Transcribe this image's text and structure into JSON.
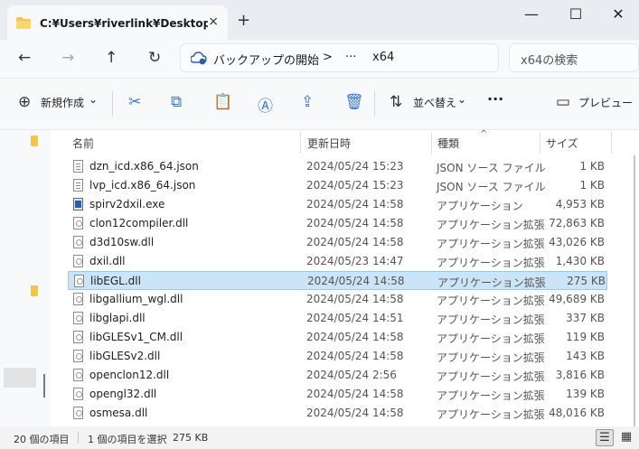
{
  "window": {
    "tab_title": "C:¥Users¥riverlink¥Desktop¥新",
    "tab_close_icon": "×",
    "new_tab_icon": "+",
    "minimize_icon": "—",
    "maximize_icon": "☐",
    "close_icon": "✕"
  },
  "nav": {
    "back_icon": "←",
    "forward_icon": "→",
    "up_icon": "↑",
    "refresh_icon": "↻"
  },
  "address": {
    "backup_label": "バックアップの開始",
    "chevron": ">",
    "ellipsis": "···",
    "current_folder": "x64"
  },
  "search": {
    "placeholder": "x64の検索"
  },
  "toolbar": {
    "new_label": "新規作成",
    "new_icon": "⊕",
    "dropdown_icon": "⌄",
    "cut_icon": "✂",
    "copy_icon": "⧉",
    "paste_icon": "📋",
    "rename_icon": "Ⓐ",
    "share_icon": "⇪",
    "delete_icon": "🗑",
    "sort_label": "並べ替え",
    "sort_icon": "⇅",
    "more_icon": "···",
    "preview_label": "プレビュー",
    "preview_icon": "▭"
  },
  "columns": {
    "name": "名前",
    "date": "更新日時",
    "type": "種類",
    "size": "サイズ",
    "sort_indicator": "^"
  },
  "files": [
    {
      "name": "dzn_icd.x86_64.json",
      "date": "2024/05/24 15:23",
      "type": "JSON ソース ファイル",
      "size": "1 KB",
      "kind": "json"
    },
    {
      "name": "lvp_icd.x86_64.json",
      "date": "2024/05/24 15:23",
      "type": "JSON ソース ファイル",
      "size": "1 KB",
      "kind": "json"
    },
    {
      "name": "spirv2dxil.exe",
      "date": "2024/05/24 14:58",
      "type": "アプリケーション",
      "size": "4,953 KB",
      "kind": "exe"
    },
    {
      "name": "clon12compiler.dll",
      "date": "2024/05/24 14:58",
      "type": "アプリケーション拡張",
      "size": "72,863 KB",
      "kind": "dll"
    },
    {
      "name": "d3d10sw.dll",
      "date": "2024/05/24 14:58",
      "type": "アプリケーション拡張",
      "size": "43,026 KB",
      "kind": "dll"
    },
    {
      "name": "dxil.dll",
      "date": "2024/05/23 14:47",
      "type": "アプリケーション拡張",
      "size": "1,430 KB",
      "kind": "dll"
    },
    {
      "name": "libEGL.dll",
      "date": "2024/05/24 14:58",
      "type": "アプリケーション拡張",
      "size": "275 KB",
      "kind": "dll",
      "selected": true
    },
    {
      "name": "libgallium_wgl.dll",
      "date": "2024/05/24 14:58",
      "type": "アプリケーション拡張",
      "size": "49,689 KB",
      "kind": "dll"
    },
    {
      "name": "libglapi.dll",
      "date": "2024/05/24 14:51",
      "type": "アプリケーション拡張",
      "size": "337 KB",
      "kind": "dll"
    },
    {
      "name": "libGLESv1_CM.dll",
      "date": "2024/05/24 14:58",
      "type": "アプリケーション拡張",
      "size": "119 KB",
      "kind": "dll"
    },
    {
      "name": "libGLESv2.dll",
      "date": "2024/05/24 14:58",
      "type": "アプリケーション拡張",
      "size": "143 KB",
      "kind": "dll"
    },
    {
      "name": "openclon12.dll",
      "date": "2024/05/24 2:56",
      "type": "アプリケーション拡張",
      "size": "3,816 KB",
      "kind": "dll"
    },
    {
      "name": "opengl32.dll",
      "date": "2024/05/24 14:58",
      "type": "アプリケーション拡張",
      "size": "139 KB",
      "kind": "dll"
    },
    {
      "name": "osmesa.dll",
      "date": "2024/05/24 14:58",
      "type": "アプリケーション拡張",
      "size": "48,016 KB",
      "kind": "dll"
    }
  ],
  "status": {
    "item_count": "20 個の項目",
    "selection": "1 個の項目を選択",
    "selection_size": "275 KB",
    "details_view_icon": "☰",
    "tiles_view_icon": "▦"
  },
  "colors": {
    "selection": "#cce4f7",
    "accent": "#3a78c8",
    "folder": "#f4c44e"
  }
}
